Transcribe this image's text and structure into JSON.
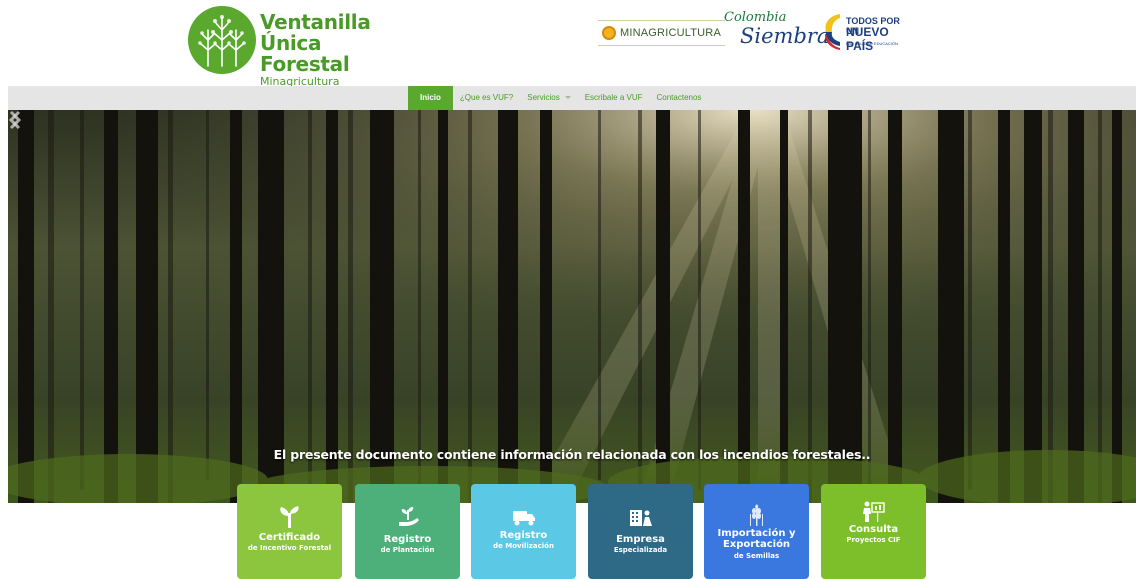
{
  "header": {
    "logo": {
      "line1": "Ventanilla",
      "line2": "Única Forestal",
      "line3": "Minagricultura"
    },
    "partners": {
      "minagricultura": "MINAGRICULTURA",
      "colombia_siembra_top": "Colombia",
      "colombia_siembra_main": "Siembra",
      "nuevo_pais_line1": "TODOS POR UN",
      "nuevo_pais_line2": "NUEVO PAÍS",
      "nuevo_pais_line3": "PAZ   EQUIDAD   EDUCACIÓN"
    }
  },
  "nav": {
    "items": [
      {
        "label": "Inicio",
        "active": true
      },
      {
        "label": "¿Que es VUF?"
      },
      {
        "label": "Servicios"
      },
      {
        "label": "Escribale a VUF"
      },
      {
        "label": "Contactenos"
      }
    ]
  },
  "hero": {
    "caption": "El presente documento contiene información relacionada con los incendios forestales..",
    "prev_icon": "chevron-left-icon",
    "next_icon": "chevron-right-icon"
  },
  "tiles": [
    {
      "title": "Certificado",
      "subtitle": "de Incentivo Forestal",
      "color": "#8cc63f",
      "icon": "sprout-icon"
    },
    {
      "title": "Registro",
      "subtitle": "de Plantación",
      "color": "#4db07a",
      "icon": "hand-plant-icon"
    },
    {
      "title": "Registro",
      "subtitle": "de Movilización",
      "color": "#5bc8e6",
      "icon": "truck-icon"
    },
    {
      "title": "Empresa",
      "subtitle": "Especializada",
      "color": "#2e6a86",
      "icon": "building-person-icon"
    },
    {
      "title": "Importación y Exportación",
      "subtitle": "de Semillas",
      "color": "#3a78e0",
      "icon": "wheat-icon"
    },
    {
      "title": "Consulta",
      "subtitle": "Proyectos CIF",
      "color": "#7cbf2b",
      "icon": "presentation-icon"
    }
  ]
}
